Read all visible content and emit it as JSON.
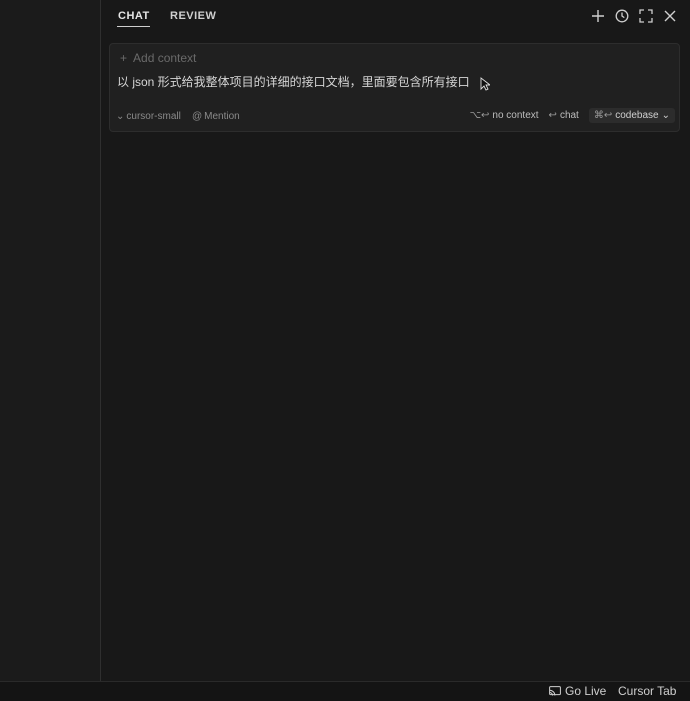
{
  "tabs": [
    {
      "label": "CHAT",
      "active": true
    },
    {
      "label": "REVIEW",
      "active": false
    }
  ],
  "toolbar": {
    "icons": [
      "plus-icon",
      "history-icon",
      "expand-icon",
      "close-icon"
    ]
  },
  "composer": {
    "add_context_label": "Add context",
    "prompt": "以 json 形式给我整体项目的详细的接口文档，里面要包含所有接口",
    "model": "cursor-small",
    "mention_label": "Mention",
    "actions": {
      "no_context_kbd": "⌥↩",
      "no_context_label": "no context",
      "chat_kbd": "↩",
      "chat_label": "chat",
      "codebase_kbd": "⌘↩",
      "codebase_label": "codebase"
    }
  },
  "statusbar": {
    "go_live": "Go Live",
    "cursor_tab": "Cursor Tab"
  },
  "colors": {
    "panel_bg": "#181818",
    "input_bg": "#202020",
    "text": "#cccccc",
    "muted": "#6a6a6a"
  }
}
